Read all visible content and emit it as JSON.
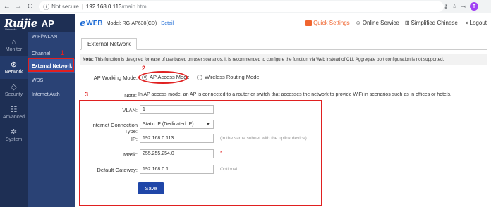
{
  "browser": {
    "back": "←",
    "forward": "→",
    "reload": "C",
    "security": "Not secure",
    "url_host": "192.168.0.113",
    "url_path": "/main.htm"
  },
  "topbar": {
    "logo": "Ruijie",
    "logo_suffix": "AP",
    "logo_sub": "Networks",
    "web_e": "e",
    "web_word": "WEB",
    "model": "Model: RG-AP630(CD)",
    "detail": "Detail",
    "actions": [
      "Quick Settings",
      "Online Service",
      "Simplified Chinese",
      "Logout"
    ]
  },
  "leftnav": [
    {
      "label": "Monitor",
      "icon": "house-icon",
      "glyph": "⌂"
    },
    {
      "label": "Network",
      "icon": "network-icon",
      "glyph": "⊛",
      "active": true
    },
    {
      "label": "Security",
      "icon": "shield-icon",
      "glyph": "◇"
    },
    {
      "label": "Advanced",
      "icon": "users-icon",
      "glyph": "☷"
    },
    {
      "label": "System",
      "icon": "gear-icon",
      "glyph": "✲"
    }
  ],
  "subnav": [
    "WiFi/WLAN",
    "Channel",
    "External Network",
    "WDS",
    "Internet Auth"
  ],
  "main": {
    "tab": "External Network",
    "note_bold": "Note:",
    "note": "This function is designed for ease of use based on user scenarios. It is recommended to configure the function via Web instead of CLI. Aggregate port configuration is not supported.",
    "work_mode_label": "AP Working Mode:",
    "mode_ap": "AP Access Mode",
    "mode_router": "Wireless Routing Mode",
    "note2_label": "Note:",
    "note2": "In AP access mode, an AP is connected to a router or switch that accesses the network to provide WiFi in scenarios such as in offices or hotels.",
    "vlan_label": "VLAN:",
    "vlan_value": "1",
    "conn_label": "Internet Connection Type:",
    "conn_value": "Static IP (Dedicated IP)",
    "ip_label": "IP:",
    "ip_value": "192.168.0.113",
    "ip_hint": "(in the same subnet with the uplink device)",
    "mask_label": "Mask:",
    "mask_value": "255.255.254.0",
    "mask_hint": "*",
    "gw_label": "Default Gateway:",
    "gw_value": "192.168.0.1",
    "gw_hint": "Optional",
    "save": "Save"
  },
  "annotations": {
    "one": "1",
    "two": "2",
    "three": "3",
    "color": "#e02020"
  }
}
